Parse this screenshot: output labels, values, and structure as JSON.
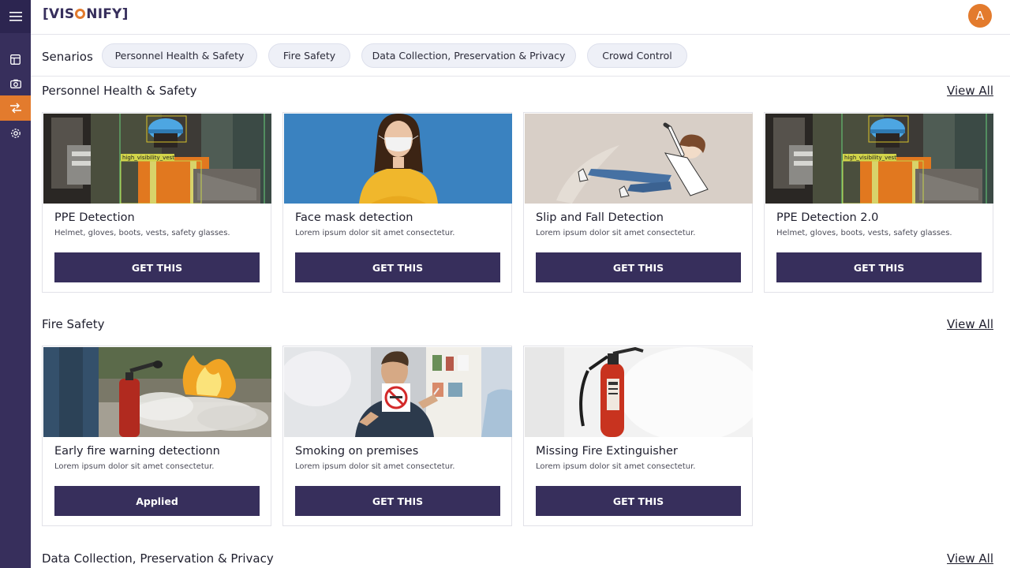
{
  "header": {
    "logo_left": "[VIS",
    "logo_right": "NIFY]",
    "avatar_initial": "A"
  },
  "scenarios": {
    "label": "Senarios",
    "chips": [
      "Personnel Health & Safety",
      "Fire Safety",
      "Data Collection, Preservation & Privacy",
      "Crowd Control"
    ]
  },
  "sections": [
    {
      "title": "Personnel Health & Safety",
      "view_all": "View All",
      "cards": [
        {
          "title": "PPE Detection",
          "desc": "Helmet, gloves, boots, vests, safety glasses.",
          "button": "GET THIS",
          "image": "ppe-worker-image",
          "overlay_label": "high_visibility_vest"
        },
        {
          "title": "Face mask detection",
          "desc": "Lorem ipsum dolor sit amet consectetur.",
          "button": "GET THIS",
          "image": "masked-woman-image"
        },
        {
          "title": "Slip and Fall Detection",
          "desc": "Lorem ipsum dolor sit amet consectetur.",
          "button": "GET THIS",
          "image": "falling-man-illustration"
        },
        {
          "title": "PPE Detection 2.0",
          "desc": "Helmet, gloves, boots, vests, safety glasses.",
          "button": "GET THIS",
          "image": "ppe-worker-image",
          "overlay_label": "high_visibility_vest"
        }
      ]
    },
    {
      "title": "Fire Safety",
      "view_all": "View All",
      "cards": [
        {
          "title": "Early fire warning detectionn",
          "desc": "Lorem ipsum dolor sit amet consectetur.",
          "button": "Applied",
          "image": "fire-extinguishing-image"
        },
        {
          "title": "Smoking on premises",
          "desc": "Lorem ipsum dolor sit amet consectetur.",
          "button": "GET THIS",
          "image": "no-smoking-sign-image"
        },
        {
          "title": "Missing Fire Extinguisher",
          "desc": "Lorem ipsum dolor sit amet consectetur.",
          "button": "GET THIS",
          "image": "fire-extinguisher-image"
        }
      ]
    },
    {
      "title": "Data Collection, Preservation & Privacy",
      "view_all": "View All"
    }
  ],
  "colors": {
    "sidebar": "#372f5c",
    "accent": "#e37b2d",
    "button": "#372f5c",
    "chip_bg": "#eef0f7"
  },
  "sidebar_icons": [
    "menu-icon",
    "dashboard-icon",
    "camera-icon",
    "scenarios-icon",
    "settings-icon"
  ]
}
